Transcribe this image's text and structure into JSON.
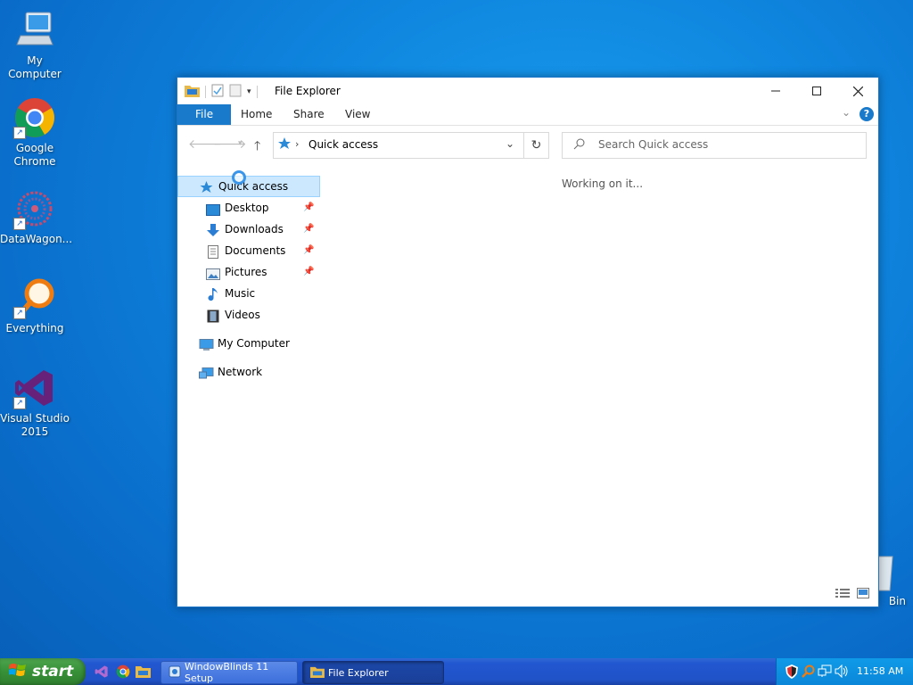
{
  "desktop": {
    "icons": [
      {
        "label": "My Computer"
      },
      {
        "label": "Google Chrome"
      },
      {
        "label": "DataWagon..."
      },
      {
        "label": "Everything"
      },
      {
        "label": "Visual Studio 2015"
      },
      {
        "label": "Bin"
      }
    ]
  },
  "window": {
    "title": "File Explorer",
    "ribbon_tabs": [
      "File",
      "Home",
      "Share",
      "View"
    ],
    "address": {
      "path": "Quick access"
    },
    "search": {
      "placeholder": "Search Quick access"
    },
    "status_text": "Working on it...",
    "nav": {
      "quick_access": "Quick access",
      "items": [
        {
          "label": "Desktop",
          "pinned": true
        },
        {
          "label": "Downloads",
          "pinned": true
        },
        {
          "label": "Documents",
          "pinned": true
        },
        {
          "label": "Pictures",
          "pinned": true
        },
        {
          "label": "Music",
          "pinned": false
        },
        {
          "label": "Videos",
          "pinned": false
        }
      ],
      "my_computer": "My Computer",
      "network": "Network"
    }
  },
  "taskbar": {
    "start_label": "start",
    "buttons": [
      {
        "label": "WindowBlinds 11 Setup"
      },
      {
        "label": "File Explorer"
      }
    ],
    "clock": "11:58 AM"
  },
  "colors": {
    "accent": "#1979ca",
    "selection": "#cce8ff",
    "taskbar": "#2157d0",
    "start": "#379137"
  }
}
